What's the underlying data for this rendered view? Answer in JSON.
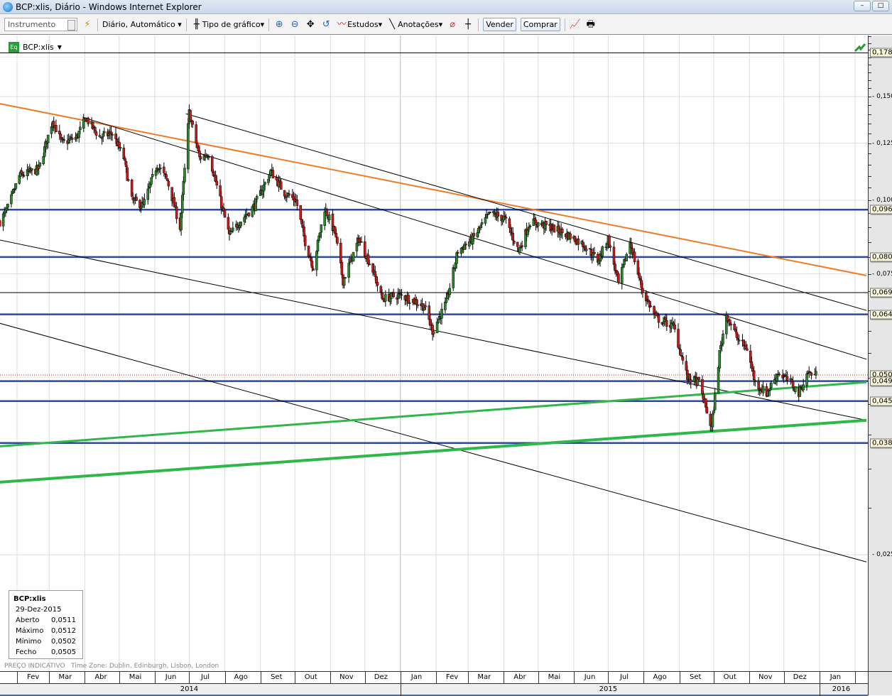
{
  "window": {
    "title": "BCP:xlis, Diário - Windows Internet Explorer"
  },
  "toolbar": {
    "instrument_placeholder": "Instrumento",
    "interval": "Diário,  Automático",
    "chart_type": "Tipo de gráfico",
    "studies": "Estudos",
    "annotations": "Anotações",
    "sell": "Vender",
    "buy": "Comprar"
  },
  "legend": {
    "symbol": "BCP:xlis",
    "badge": "Eq"
  },
  "info": {
    "symbol": "BCP:xlis",
    "date": "29-Dez-2015",
    "rows": [
      {
        "label": "Aberto",
        "value": "0,0511"
      },
      {
        "label": "Máximo",
        "value": "0,0512"
      },
      {
        "label": "Mínimo",
        "value": "0,0502"
      },
      {
        "label": "Fecho",
        "value": "0,0505"
      }
    ]
  },
  "footnote": {
    "price": "PREÇO INDICATIVO",
    "timezone": "Time Zone: Dublin, Edinburgh, Lisbon, London"
  },
  "chart_data": {
    "type": "candlestick",
    "title": "BCP:xlis, Diário",
    "scale": "log",
    "xrange": [
      "2014-01-17",
      "2016-02-11"
    ],
    "x_ticks": [
      {
        "label": "Fev",
        "date": "2014-02-15"
      },
      {
        "label": "Mar",
        "date": "2014-03-15"
      },
      {
        "label": "Abr",
        "date": "2014-04-15"
      },
      {
        "label": "Mai",
        "date": "2014-05-15"
      },
      {
        "label": "Jun",
        "date": "2014-06-15"
      },
      {
        "label": "Jul",
        "date": "2014-07-15"
      },
      {
        "label": "Ago",
        "date": "2014-08-15"
      },
      {
        "label": "Set",
        "date": "2014-09-15"
      },
      {
        "label": "Out",
        "date": "2014-10-15"
      },
      {
        "label": "Nov",
        "date": "2014-11-15"
      },
      {
        "label": "Dez",
        "date": "2014-12-15"
      },
      {
        "label": "Jan",
        "date": "2015-01-15"
      },
      {
        "label": "Fev",
        "date": "2015-02-15"
      },
      {
        "label": "Mar",
        "date": "2015-03-15"
      },
      {
        "label": "Abr",
        "date": "2015-04-15"
      },
      {
        "label": "Mai",
        "date": "2015-05-15"
      },
      {
        "label": "Jun",
        "date": "2015-06-15"
      },
      {
        "label": "Jul",
        "date": "2015-07-15"
      },
      {
        "label": "Ago",
        "date": "2015-08-15"
      },
      {
        "label": "Set",
        "date": "2015-09-15"
      },
      {
        "label": "Out",
        "date": "2015-10-15"
      },
      {
        "label": "Nov",
        "date": "2015-11-15"
      },
      {
        "label": "Dez",
        "date": "2015-12-15"
      },
      {
        "label": "Jan",
        "date": "2016-01-15"
      }
    ],
    "years": [
      {
        "label": "2014",
        "date": "2014-07-01"
      },
      {
        "label": "2015",
        "date": "2015-07-01"
      },
      {
        "label": "2016",
        "date": "2016-01-20"
      }
    ],
    "y_ticks": [
      {
        "label": "0,150",
        "value": 0.15
      },
      {
        "label": "0,125",
        "value": 0.125
      },
      {
        "label": "0,100",
        "value": 0.1
      },
      {
        "label": "0,075",
        "value": 0.075
      },
      {
        "label": "0,025",
        "value": 0.025
      }
    ],
    "price_path": [
      [
        "2014-01-17",
        0.092
      ],
      [
        "2014-01-24",
        0.097
      ],
      [
        "2014-02-03",
        0.11
      ],
      [
        "2014-02-20",
        0.113
      ],
      [
        "2014-03-04",
        0.137
      ],
      [
        "2014-03-12",
        0.125
      ],
      [
        "2014-03-25",
        0.128
      ],
      [
        "2014-04-02",
        0.138
      ],
      [
        "2014-04-14",
        0.128
      ],
      [
        "2014-04-25",
        0.13
      ],
      [
        "2014-05-05",
        0.118
      ],
      [
        "2014-05-12",
        0.1
      ],
      [
        "2014-05-22",
        0.098
      ],
      [
        "2014-06-03",
        0.115
      ],
      [
        "2014-06-12",
        0.108
      ],
      [
        "2014-06-23",
        0.09
      ],
      [
        "2014-07-01",
        0.141
      ],
      [
        "2014-07-10",
        0.118
      ],
      [
        "2014-07-18",
        0.12
      ],
      [
        "2014-07-28",
        0.1
      ],
      [
        "2014-08-05",
        0.087
      ],
      [
        "2014-08-14",
        0.092
      ],
      [
        "2014-08-27",
        0.098
      ],
      [
        "2014-09-10",
        0.112
      ],
      [
        "2014-09-22",
        0.103
      ],
      [
        "2014-10-02",
        0.1
      ],
      [
        "2014-10-10",
        0.085
      ],
      [
        "2014-10-17",
        0.077
      ],
      [
        "2014-10-27",
        0.097
      ],
      [
        "2014-11-05",
        0.088
      ],
      [
        "2014-11-12",
        0.073
      ],
      [
        "2014-11-26",
        0.086
      ],
      [
        "2014-12-08",
        0.076
      ],
      [
        "2014-12-16",
        0.068
      ],
      [
        "2014-12-30",
        0.069
      ],
      [
        "2015-01-10",
        0.068
      ],
      [
        "2015-01-22",
        0.066
      ],
      [
        "2015-01-29",
        0.06
      ],
      [
        "2015-02-10",
        0.067
      ],
      [
        "2015-02-20",
        0.082
      ],
      [
        "2015-03-05",
        0.086
      ],
      [
        "2015-03-20",
        0.095
      ],
      [
        "2015-04-02",
        0.093
      ],
      [
        "2015-04-14",
        0.082
      ],
      [
        "2015-04-24",
        0.092
      ],
      [
        "2015-05-12",
        0.09
      ],
      [
        "2015-05-28",
        0.087
      ],
      [
        "2015-06-10",
        0.084
      ],
      [
        "2015-06-22",
        0.079
      ],
      [
        "2015-07-01",
        0.086
      ],
      [
        "2015-07-10",
        0.072
      ],
      [
        "2015-07-20",
        0.085
      ],
      [
        "2015-07-31",
        0.07
      ],
      [
        "2015-08-12",
        0.063
      ],
      [
        "2015-08-20",
        0.062
      ],
      [
        "2015-08-27",
        0.061
      ],
      [
        "2015-09-08",
        0.05
      ],
      [
        "2015-09-18",
        0.049
      ],
      [
        "2015-09-29",
        0.041
      ],
      [
        "2015-10-06",
        0.055
      ],
      [
        "2015-10-12",
        0.064
      ],
      [
        "2015-10-22",
        0.058
      ],
      [
        "2015-10-30",
        0.056
      ],
      [
        "2015-11-06",
        0.049
      ],
      [
        "2015-11-16",
        0.047
      ],
      [
        "2015-11-26",
        0.051
      ],
      [
        "2015-12-07",
        0.049
      ],
      [
        "2015-12-14",
        0.047
      ],
      [
        "2015-12-22",
        0.051
      ],
      [
        "2015-12-29",
        0.0505
      ]
    ],
    "horizontal_lines": [
      {
        "value": 0.178,
        "color": "#000000",
        "label": "0,178"
      },
      {
        "value": 0.0964,
        "color": "#2e4a9e",
        "label": "0,096"
      },
      {
        "value": 0.0801,
        "color": "#2e4a9e",
        "label": "0,080"
      },
      {
        "value": 0.0697,
        "color": "#000000",
        "label": "0,069"
      },
      {
        "value": 0.064,
        "color": "#2e4a9e",
        "label": "0,064"
      },
      {
        "value": 0.0505,
        "color": "#e02020",
        "label": "0,050",
        "dotted": true
      },
      {
        "value": 0.0493,
        "color": "#2e4a9e",
        "label": "0,049"
      },
      {
        "value": 0.0456,
        "color": "#2e4a9e",
        "label": "0,045"
      },
      {
        "value": 0.0387,
        "color": "#2e4a9e",
        "label": "0,038"
      }
    ],
    "trendlines": [
      {
        "name": "orange-resistance",
        "color": "#f07a28",
        "from": [
          "2014-01-17",
          0.1459
        ],
        "to": [
          "2016-02-11",
          0.0745
        ]
      },
      {
        "name": "channel-top",
        "color": "#000000",
        "from": [
          "2014-06-28",
          0.1403
        ],
        "to": [
          "2016-02-11",
          0.065
        ]
      },
      {
        "name": "channel-mid",
        "color": "#000000",
        "from": [
          "2014-03-30",
          0.1384
        ],
        "to": [
          "2016-02-11",
          0.0537
        ]
      },
      {
        "name": "channel-lower",
        "color": "#000000",
        "from": [
          "2014-01-17",
          0.0856
        ],
        "to": [
          "2016-02-11",
          0.0423
        ]
      },
      {
        "name": "channel-bottom",
        "color": "#000000",
        "from": [
          "2014-01-17",
          0.0618
        ],
        "to": [
          "2016-02-11",
          0.0243
        ]
      },
      {
        "name": "green-support-1",
        "color": "#2fb84a",
        "from": [
          "2014-01-17",
          0.0382
        ],
        "to": [
          "2016-02-11",
          0.0491
        ]
      },
      {
        "name": "green-support-2",
        "color": "#2fb84a",
        "from": [
          "2014-01-17",
          0.0332
        ],
        "to": [
          "2016-02-11",
          0.0423
        ]
      }
    ],
    "colors": {
      "up": "#2a8a2a",
      "down": "#d01818",
      "wick": "#000000"
    }
  }
}
